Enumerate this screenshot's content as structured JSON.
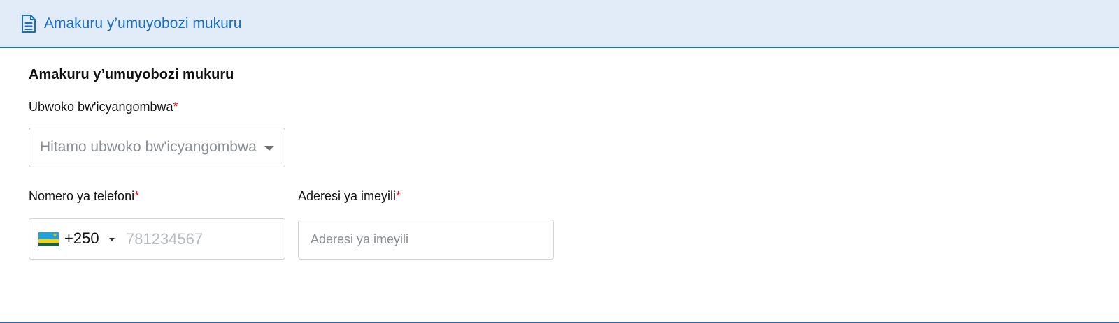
{
  "header": {
    "title": "Amakuru y’umuyobozi mukuru",
    "icon": "document-icon"
  },
  "section": {
    "title": "Amakuru y’umuyobozi mukuru"
  },
  "contract_type": {
    "label": "Ubwoko bw'icyangombwa",
    "required_mark": "*",
    "placeholder": "Hitamo ubwoko bw'icyangombwa"
  },
  "phone": {
    "label": "Nomero ya telefoni",
    "required_mark": "*",
    "country_flag": "rwanda-flag-icon",
    "dial_code": "+250",
    "placeholder": "781234567",
    "value": ""
  },
  "email": {
    "label": "Aderesi ya imeyili",
    "required_mark": "*",
    "placeholder": "Aderesi ya imeyili",
    "value": ""
  },
  "colors": {
    "accent": "#1a6fc4",
    "header_bg": "#e1ecf8",
    "required": "#e0192b"
  }
}
